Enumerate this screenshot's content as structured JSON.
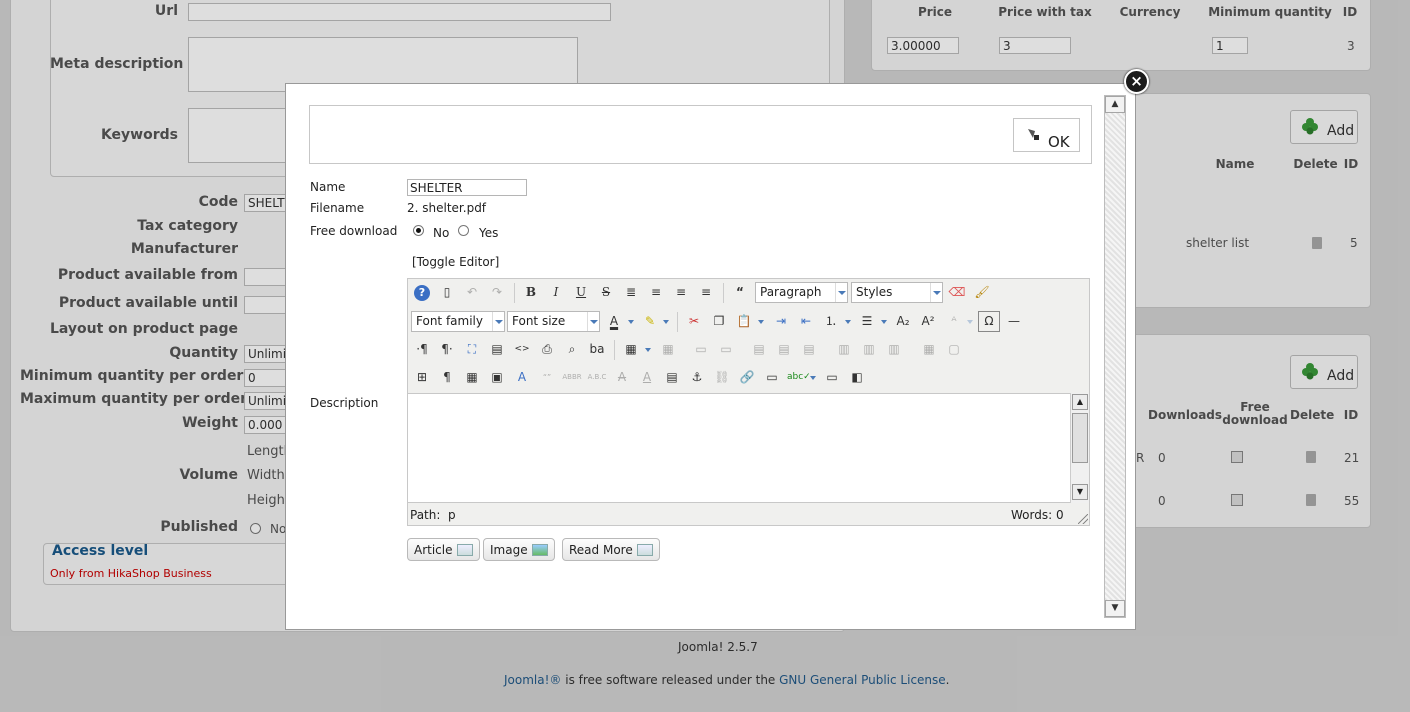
{
  "background": {
    "fields": {
      "url_label": "Url",
      "meta_description_label": "Meta description",
      "keywords_label": "Keywords",
      "code_label": "Code",
      "code_value": "SHELT",
      "tax_category_label": "Tax category",
      "manufacturer_label": "Manufacturer",
      "available_from_label": "Product available from",
      "available_until_label": "Product available until",
      "layout_label": "Layout on product page",
      "quantity_label": "Quantity",
      "quantity_value": "Unlimit",
      "min_qty_label": "Minimum quantity per order",
      "min_qty_value": "0",
      "max_qty_label": "Maximum quantity per order",
      "max_qty_value": "Unlimit",
      "weight_label": "Weight",
      "weight_value": "0.000",
      "volume_label": "Volume",
      "length_label": "Length",
      "width_label": "Width",
      "height_label": "Height",
      "published_label": "Published",
      "published_no": "No",
      "access_level_title": "Access level",
      "access_level_value": "Only from HikaShop Business"
    },
    "prices_table": {
      "headers": [
        "Price",
        "Price with tax",
        "Currency",
        "Minimum quantity",
        "ID"
      ],
      "row": {
        "price": "3.00000",
        "price_tax": "3",
        "min_qty": "1",
        "id": "3"
      }
    },
    "images_table": {
      "add_label": "Add",
      "headers": [
        "Name",
        "Delete",
        "ID"
      ],
      "row": {
        "name": "shelter list",
        "id": "5"
      }
    },
    "files_table": {
      "add_label": "Add",
      "headers": [
        "Downloads",
        "Free download",
        "Delete",
        "ID"
      ],
      "rows": [
        {
          "prefix": "R",
          "downloads": "0",
          "id": "21"
        },
        {
          "prefix": "",
          "downloads": "0",
          "id": "55"
        }
      ]
    }
  },
  "footer": {
    "version": "Joomla! 2.5.7",
    "brand": "Joomla!®",
    "license_prefix": " is free software released under the ",
    "license_link": "GNU General Public License",
    "license_suffix": "."
  },
  "modal": {
    "ok_label": "OK",
    "name_label": "Name",
    "name_value": "SHELTER",
    "filename_label": "Filename",
    "filename_value": "2. shelter.pdf",
    "free_download_label": "Free download",
    "free_no": "No",
    "free_yes": "Yes",
    "toggle_editor": "[Toggle Editor]",
    "description_label": "Description",
    "editor": {
      "format_select": "Paragraph",
      "styles_select": "Styles",
      "font_family_select": "Font family",
      "font_size_select": "Font size",
      "path_label": "Path:",
      "path_value": "p",
      "words_label": "Words: 0"
    },
    "buttons": {
      "article": "Article",
      "image": "Image",
      "read_more": "Read More"
    }
  }
}
